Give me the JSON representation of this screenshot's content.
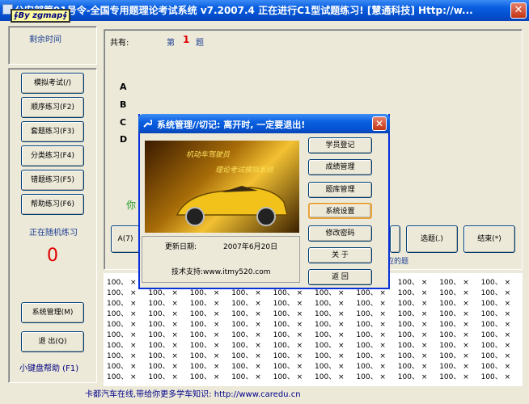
{
  "window": {
    "title": "公安部第91号令-全国专用题理论考试系统  v7.2007.4  正在进行C1型试题练习! [慧通科技] Http://w...",
    "close_glyph": "✕",
    "badge": "∮By zgmap∮"
  },
  "left": {
    "remaining_time_label": "剩余时间",
    "buttons": [
      "模拟考试(/)",
      "顺序练习(F2)",
      "套题练习(F3)",
      "分类练习(F4)",
      "错题练习(F5)",
      "帮助练习(F6)"
    ],
    "status_label": "正在随机练习",
    "counter": "0",
    "sys_button": "系统管理(M)",
    "exit_button": "退  出(Q)",
    "keyboard_help": "小键盘帮助 (F1)"
  },
  "question": {
    "total_label": "共有:",
    "position_prefix": "第",
    "position_number": "1",
    "position_suffix": "题",
    "options": [
      "A",
      "B",
      "C",
      "D"
    ],
    "hint_fragment": "你",
    "hint2_fragment": "应的题"
  },
  "answer_buttons": {
    "a": "A(7)",
    "select": "选题(.)",
    "end": "结束(*)"
  },
  "grid": {
    "cell_text": "100、",
    "cell_mark": "×",
    "rows": 10,
    "cols": 10
  },
  "footer": {
    "text": "卡都汽车在线,带给你更多学车知识: http://www.caredu.cn"
  },
  "dialog": {
    "title": "系统管理//切记: 离开时, 一定要退出!",
    "close_glyph": "✕",
    "image_line1": "机动车驾驶员",
    "image_line2": "理论考试模拟系统",
    "update_label": "更新日期:",
    "update_value": "2007年6月20日",
    "support": "技术支持:www.itmy520.com",
    "buttons": [
      "学员登记",
      "成绩管理",
      "题库管理",
      "系统设置",
      "修改密码",
      "关  于",
      "返  回"
    ]
  },
  "colors": {
    "accent_red": "#e00000",
    "label_blue": "#1d3f94",
    "hint_green": "#2a9a2a"
  }
}
